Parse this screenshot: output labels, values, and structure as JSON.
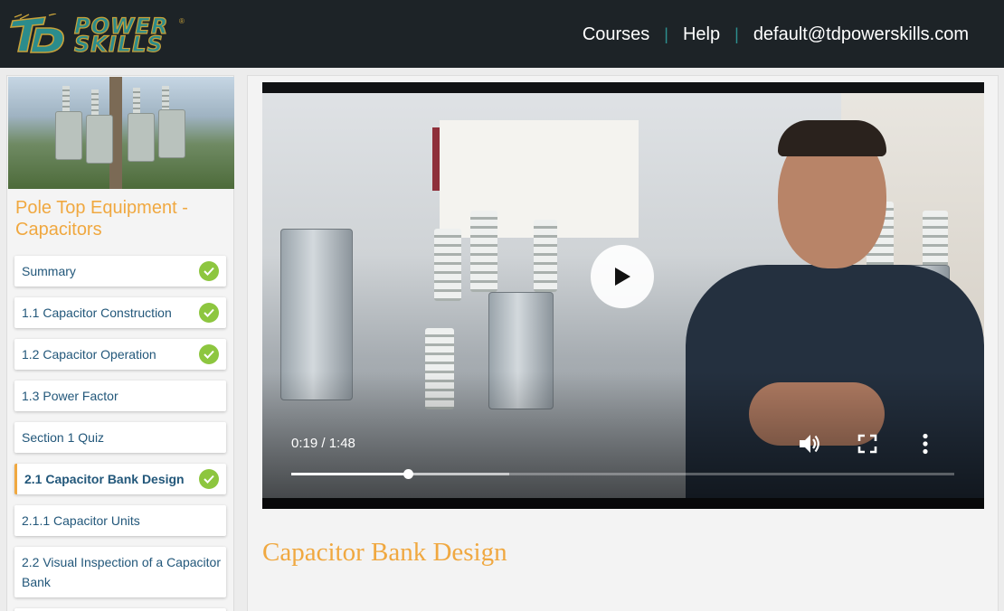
{
  "header": {
    "logo": {
      "line1": "POWER",
      "line2": "SKILLS",
      "monogram": "TD",
      "mark": "®"
    },
    "nav": [
      {
        "label": "Courses"
      },
      {
        "label": "Help"
      },
      {
        "label": "default@tdpowerskills.com"
      }
    ]
  },
  "sidebar": {
    "course_title": "Pole Top Equipment - Capacitors",
    "lessons": [
      {
        "label": "Summary",
        "completed": true,
        "active": false
      },
      {
        "label": "1.1 Capacitor Construction",
        "completed": true,
        "active": false
      },
      {
        "label": "1.2 Capacitor Operation",
        "completed": true,
        "active": false
      },
      {
        "label": "1.3 Power Factor",
        "completed": false,
        "active": false
      },
      {
        "label": "Section 1 Quiz",
        "completed": false,
        "active": false
      },
      {
        "label": "2.1 Capacitor Bank Design",
        "completed": true,
        "active": true
      },
      {
        "label": "2.1.1 Capacitor Units",
        "completed": false,
        "active": false
      },
      {
        "label": "2.2 Visual Inspection of a Capacitor Bank",
        "completed": false,
        "active": false
      }
    ]
  },
  "player": {
    "current_time": "0:19",
    "duration": "1:48",
    "time_display": "0:19 / 1:48",
    "played_fraction": 0.176,
    "buffered_fraction": 0.329,
    "icons": [
      "play-icon",
      "volume-icon",
      "fullscreen-icon",
      "more-options-icon"
    ]
  },
  "lesson": {
    "title": "Capacitor Bank Design"
  },
  "colors": {
    "accent": "#f0a840",
    "link": "#22577a",
    "check": "#8dc63f",
    "header_bg": "#1d2327",
    "nav_sep": "#2d8f8f"
  }
}
